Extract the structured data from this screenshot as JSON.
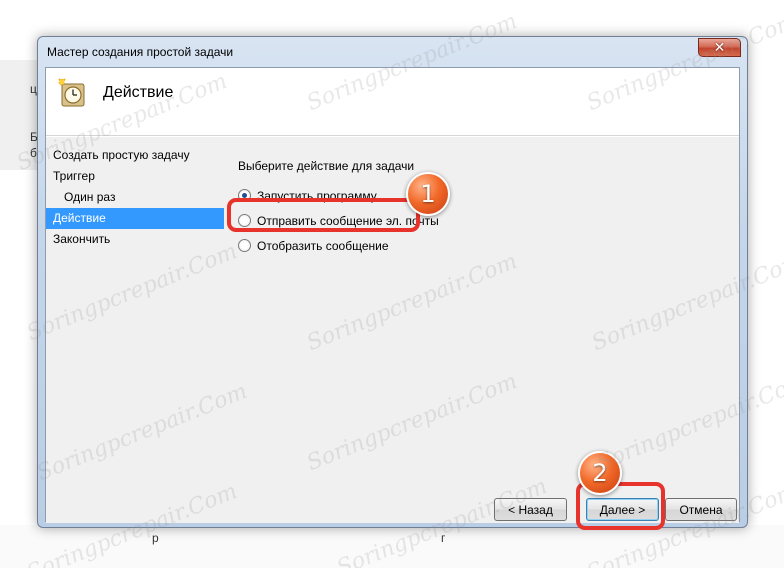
{
  "window": {
    "title": "Мастер создания простой задачи",
    "close_glyph": "✕"
  },
  "header": {
    "title": "Действие",
    "icon": "task-scheduler-icon"
  },
  "steps": [
    {
      "label": "Создать простую задачу",
      "active": false,
      "indent": false
    },
    {
      "label": "Триггер",
      "active": false,
      "indent": false
    },
    {
      "label": "Один раз",
      "active": false,
      "indent": true
    },
    {
      "label": "Действие",
      "active": true,
      "indent": false
    },
    {
      "label": "Закончить",
      "active": false,
      "indent": false
    }
  ],
  "content": {
    "prompt": "Выберите действие для задачи",
    "options": [
      {
        "label": "Запустить программу",
        "checked": true
      },
      {
        "label": "Отправить сообщение эл. почты",
        "checked": false
      },
      {
        "label": "Отобразить сообщение",
        "checked": false
      }
    ]
  },
  "buttons": {
    "back": "< Назад",
    "next": "Далее >",
    "cancel": "Отмена"
  },
  "annotations": {
    "badge_1": "1",
    "badge_2": "2",
    "color": "#e8332d"
  },
  "background": {
    "left_chars": [
      "це",
      "Б",
      "б"
    ],
    "bottom_frags": [
      "р",
      "г"
    ]
  },
  "watermark": "Soringpcrepair.Com",
  "colors": {
    "accent_selection": "#3399ff",
    "callout_red": "#e8332d",
    "badge_orange": "#f26a2a"
  }
}
